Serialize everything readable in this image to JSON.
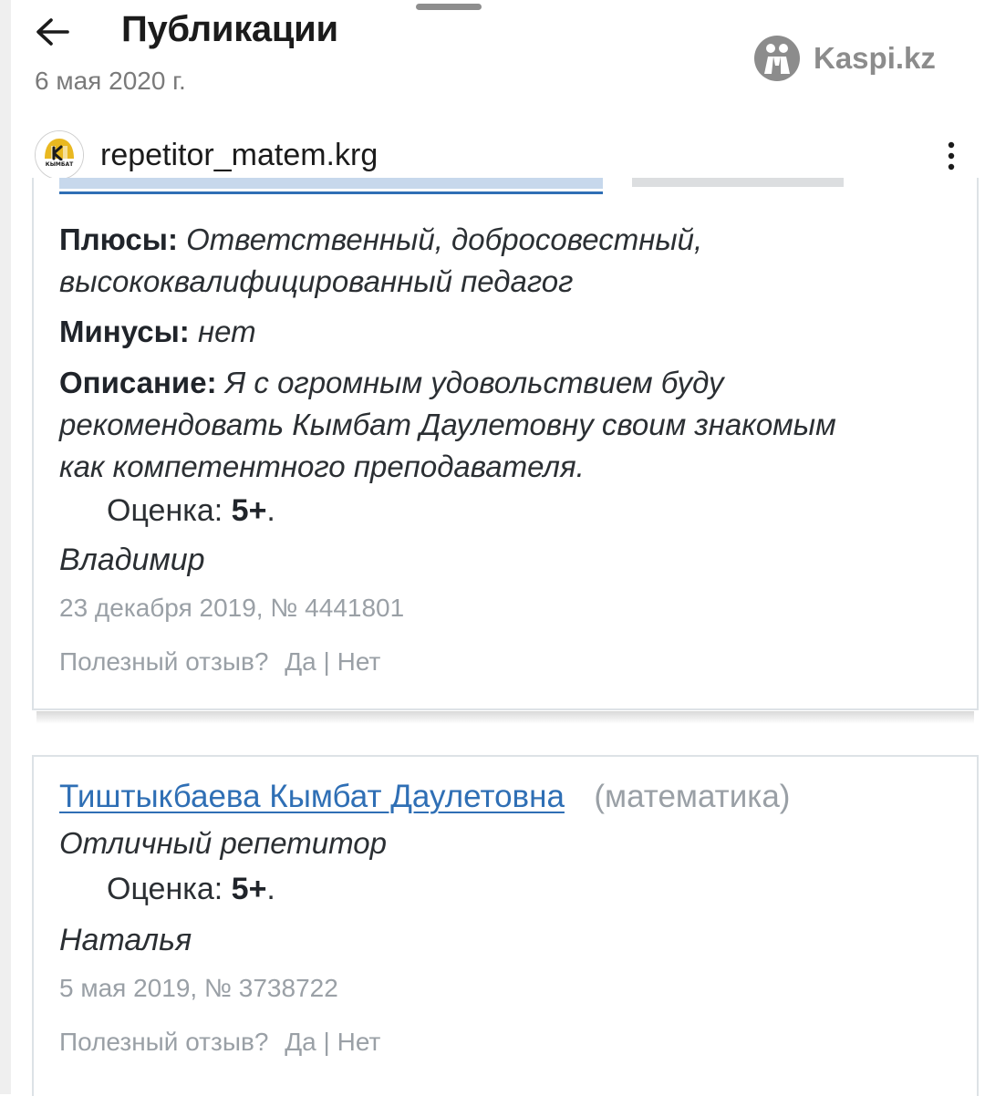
{
  "header": {
    "title": "Публикации",
    "date": "6 мая 2020 г.",
    "watermark": "Kaspi.kz"
  },
  "post": {
    "username": "repetitor_matem.krg",
    "avatar_text": "КЫМБАТ"
  },
  "reviews": [
    {
      "pros_label": "Плюсы:",
      "pros_line1": "Ответственный, добросовестный,",
      "pros_line2": "высококвалифицированный педагог",
      "cons_label": "Минусы:",
      "cons_text": "нет",
      "desc_label": "Описание:",
      "desc_line1": "Я с огромным удовольствием буду",
      "desc_line2": "рекомендовать Кымбат Даулетовну своим знакомым",
      "desc_line3": "как компетентного преподавателя.",
      "rating_label": "Оценка:",
      "rating_value": "5+",
      "author": "Владимир",
      "meta": "23 декабря 2019, № 4441801",
      "helpful_q": "Полезный отзыв?",
      "yes": "Да",
      "sep": "|",
      "no": "Нет"
    },
    {
      "teacher": "Тиштыкбаева Кымбат Даулетовна",
      "subject": "(математика)",
      "text": "Отличный репетитор",
      "rating_label": "Оценка:",
      "rating_value": "5+",
      "author": "Наталья",
      "meta": "5 мая 2019, № 3738722",
      "helpful_q": "Полезный отзыв?",
      "yes": "Да",
      "sep": "|",
      "no": "Нет"
    }
  ],
  "icons": {
    "back": "arrow-left-icon",
    "more": "more-vertical-icon",
    "watermark_logo": "kaspi-logo-icon"
  },
  "colors": {
    "link": "#2f6fb5",
    "muted": "#9aa0a6",
    "text": "#2b2f33",
    "avatar_gold": "#e9b820"
  }
}
